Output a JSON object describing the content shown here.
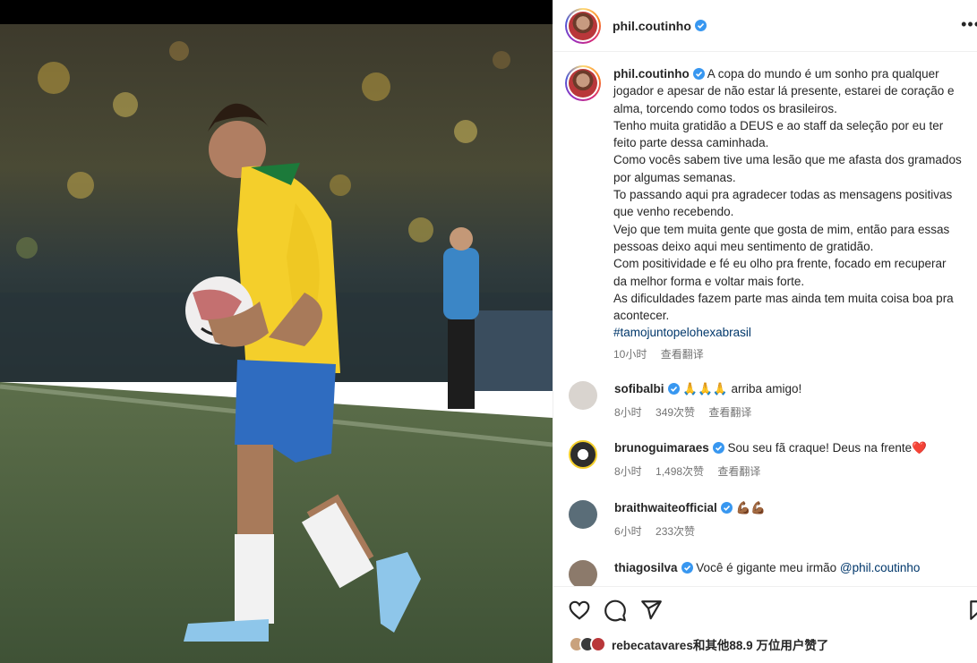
{
  "colors": {
    "verified": "#3897f0",
    "link": "#00376b",
    "secondary": "#737373",
    "heart": "#ed4956"
  },
  "post": {
    "author": "phil.coutinho",
    "more_icon": "more-horizontal-icon"
  },
  "caption": {
    "username": "phil.coutinho",
    "lines": [
      "A copa do mundo é um sonho pra qualquer",
      "jogador e apesar de não estar lá presente, estarei de coração e",
      "alma, torcendo como todos os brasileiros.",
      "Tenho muita gratidão a DEUS e ao staff da seleção por eu ter",
      "feito parte dessa caminhada.",
      "Como vocês sabem tive uma lesão que me afasta dos gramados",
      "por algumas semanas.",
      "To passando aqui pra agradecer todas as mensagens positivas",
      "que venho recebendo.",
      "Vejo que tem muita gente que gosta de mim, então para essas",
      "pessoas deixo aqui meu sentimento de gratidão.",
      "Com positividade e fé eu olho pra frente, focado em recuperar",
      "da melhor forma e voltar mais forte.",
      "As dificuldades fazem parte mas ainda tem muita coisa boa pra",
      "acontecer."
    ],
    "hashtag": "#tamojuntopelohexabrasil",
    "time": "10小时",
    "translate": "查看翻译"
  },
  "comments": [
    {
      "username": "sofibalbi",
      "text": "🙏🙏🙏 arriba amigo!",
      "time": "8小时",
      "likes": "349次赞",
      "translate": "查看翻译",
      "avatar_color": "#d9d4cf"
    },
    {
      "username": "brunoguimaraes",
      "text": "Sou seu fã craque! Deus na frente",
      "emoji": "❤️",
      "time": "8小时",
      "likes": "1,498次赞",
      "translate": "查看翻译",
      "avatar_color": "#3a3a3a"
    },
    {
      "username": "braithwaiteofficial",
      "text": "💪🏾💪🏾",
      "time": "6小时",
      "likes": "233次赞",
      "avatar_color": "#5a6d78"
    },
    {
      "username": "thiagosilva",
      "text": "Você é gigante meu irmão ",
      "mention": "@phil.coutinho",
      "avatar_color": "#8c7a6b"
    }
  ],
  "actions": {
    "like_icon": "heart-icon",
    "comment_icon": "comment-icon",
    "share_icon": "share-icon",
    "save_icon": "bookmark-icon"
  },
  "likes_text": "rebecatavares和其他88.9 万位用户赞了"
}
